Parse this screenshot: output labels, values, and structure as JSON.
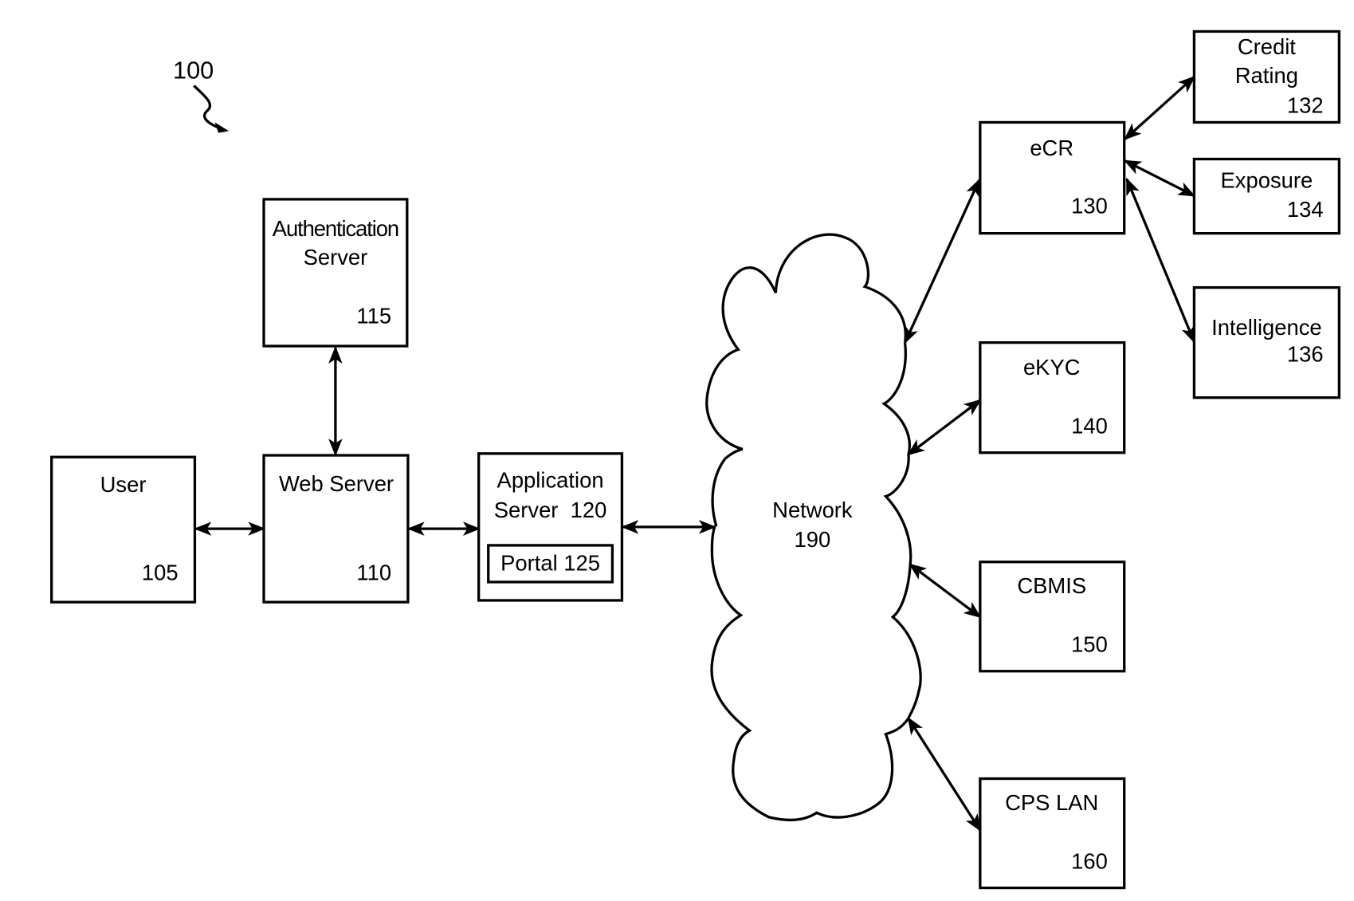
{
  "figure": {
    "ref_label": "100"
  },
  "nodes": [
    {
      "id": "user",
      "title_lines": [
        "User"
      ],
      "ref": "105"
    },
    {
      "id": "web-server",
      "title_lines": [
        "Web Server"
      ],
      "ref": "110"
    },
    {
      "id": "authentication-server",
      "title_lines": [
        "Authentication",
        "Server"
      ],
      "ref": "115"
    },
    {
      "id": "application-server",
      "title_lines": [
        "Application",
        "Server  120"
      ],
      "ref": "",
      "inner_label": "Portal 125"
    },
    {
      "id": "network",
      "title_lines": [
        "Network",
        "190"
      ],
      "ref": ""
    },
    {
      "id": "ecr",
      "title_lines": [
        "eCR"
      ],
      "ref": "130"
    },
    {
      "id": "credit-rating",
      "title_lines": [
        "Credit",
        "Rating"
      ],
      "ref": "132"
    },
    {
      "id": "exposure",
      "title_lines": [
        "Exposure"
      ],
      "ref": "134"
    },
    {
      "id": "intelligence",
      "title_lines": [
        "Intelligence"
      ],
      "ref": "136"
    },
    {
      "id": "ekyc",
      "title_lines": [
        "eKYC"
      ],
      "ref": "140"
    },
    {
      "id": "cbmis",
      "title_lines": [
        "CBMIS"
      ],
      "ref": "150"
    },
    {
      "id": "cps-lan",
      "title_lines": [
        "CPS LAN"
      ],
      "ref": "160"
    }
  ],
  "connections": [
    {
      "from": "user",
      "to": "web-server",
      "direction": "bidirectional"
    },
    {
      "from": "web-server",
      "to": "authentication-server",
      "direction": "bidirectional"
    },
    {
      "from": "web-server",
      "to": "application-server",
      "direction": "bidirectional"
    },
    {
      "from": "application-server",
      "to": "network",
      "direction": "bidirectional"
    },
    {
      "from": "network",
      "to": "ecr",
      "direction": "bidirectional"
    },
    {
      "from": "network",
      "to": "ekyc",
      "direction": "bidirectional"
    },
    {
      "from": "network",
      "to": "cbmis",
      "direction": "bidirectional"
    },
    {
      "from": "network",
      "to": "cps-lan",
      "direction": "bidirectional"
    },
    {
      "from": "ecr",
      "to": "credit-rating",
      "direction": "bidirectional"
    },
    {
      "from": "ecr",
      "to": "exposure",
      "direction": "bidirectional"
    },
    {
      "from": "ecr",
      "to": "intelligence",
      "direction": "bidirectional"
    }
  ]
}
